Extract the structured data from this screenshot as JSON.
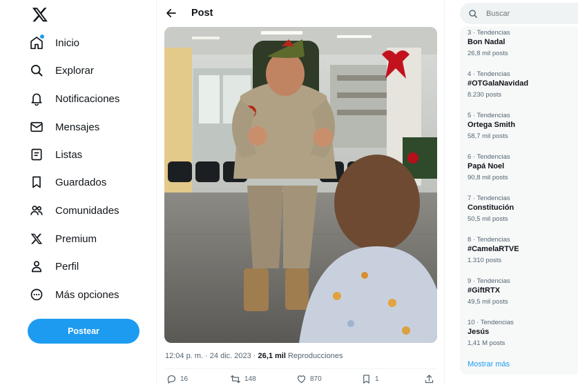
{
  "nav": {
    "items": [
      {
        "label": "Inicio",
        "icon": "home-icon"
      },
      {
        "label": "Explorar",
        "icon": "search-icon"
      },
      {
        "label": "Notificaciones",
        "icon": "bell-icon"
      },
      {
        "label": "Mensajes",
        "icon": "envelope-icon"
      },
      {
        "label": "Listas",
        "icon": "list-icon"
      },
      {
        "label": "Guardados",
        "icon": "bookmark-icon"
      },
      {
        "label": "Comunidades",
        "icon": "people-icon"
      },
      {
        "label": "Premium",
        "icon": "x-logo-icon"
      },
      {
        "label": "Perfil",
        "icon": "person-icon"
      },
      {
        "label": "Más opciones",
        "icon": "more-circle-icon"
      }
    ],
    "post_button": "Postear"
  },
  "header": {
    "title": "Post"
  },
  "post": {
    "time": "12:04 p. m. · 24 dic. 2023 · ",
    "views_count": "26,1 mil",
    "views_label": " Reproducciones",
    "replies": "16",
    "reposts": "148",
    "likes": "870",
    "bookmarks": "1"
  },
  "search": {
    "placeholder": "Buscar"
  },
  "trends": {
    "items": [
      {
        "category": "3 · Tendencias",
        "name": "Bon Nadal",
        "count": "26,8 mil posts"
      },
      {
        "category": "4 · Tendencias",
        "name": "#OTGalaNavidad",
        "count": "8.230 posts"
      },
      {
        "category": "5 · Tendencias",
        "name": "Ortega Smith",
        "count": "58,7 mil posts"
      },
      {
        "category": "6 · Tendencias",
        "name": "Papá Noel",
        "count": "90,8 mil posts"
      },
      {
        "category": "7 · Tendencias",
        "name": "Constitución",
        "count": "50,5 mil posts"
      },
      {
        "category": "8 · Tendencias",
        "name": "#CamelaRTVE",
        "count": "1.310 posts"
      },
      {
        "category": "9 · Tendencias",
        "name": "#GiftRTX",
        "count": "49,5 mil posts"
      },
      {
        "category": "10 · Tendencias",
        "name": "Jesús",
        "count": "1,41 M posts"
      }
    ],
    "show_more": "Mostrar más"
  },
  "colors": {
    "accent": "#1d9bf0",
    "text": "#0f1419",
    "muted": "#536471"
  }
}
